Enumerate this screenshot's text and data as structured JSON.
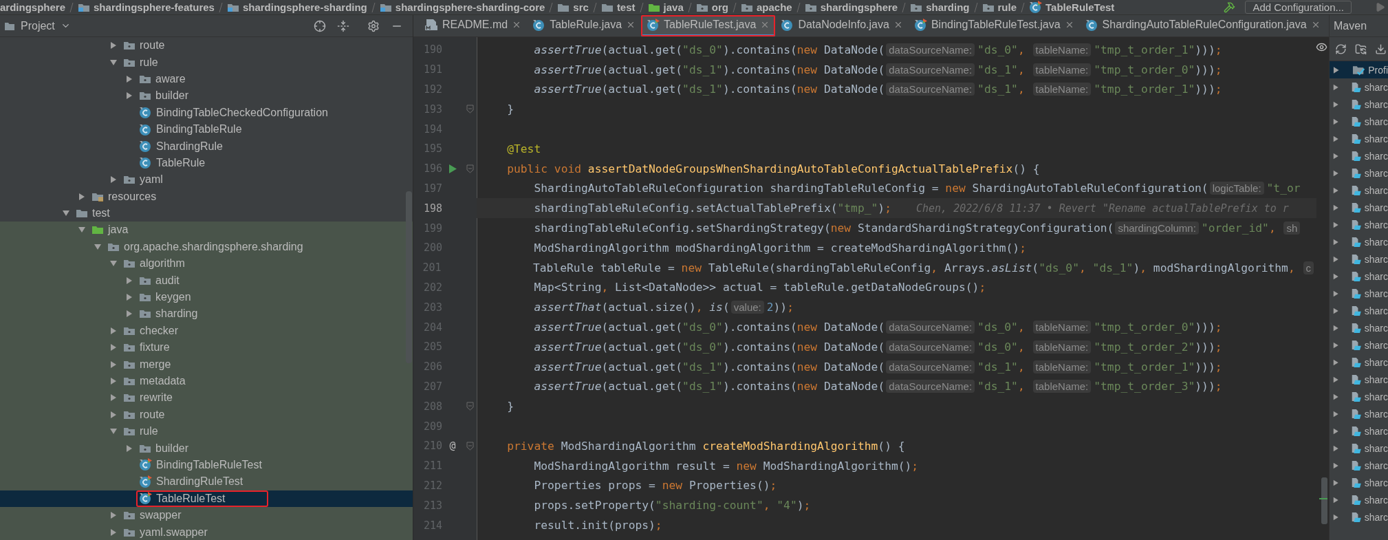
{
  "breadcrumb": [
    {
      "label": "ardingsphere",
      "kind": "none"
    },
    {
      "label": "shardingsphere-features",
      "kind": "module"
    },
    {
      "label": "shardingsphere-sharding",
      "kind": "module"
    },
    {
      "label": "shardingsphere-sharding-core",
      "kind": "module"
    },
    {
      "label": "src",
      "kind": "folder"
    },
    {
      "label": "test",
      "kind": "folder"
    },
    {
      "label": "java",
      "kind": "test-root"
    },
    {
      "label": "org",
      "kind": "package"
    },
    {
      "label": "apache",
      "kind": "package"
    },
    {
      "label": "shardingsphere",
      "kind": "package"
    },
    {
      "label": "sharding",
      "kind": "package"
    },
    {
      "label": "rule",
      "kind": "package"
    },
    {
      "label": "TableRuleTest",
      "kind": "test-class"
    }
  ],
  "run_config": {
    "label": "Add Configuration..."
  },
  "project_panel": {
    "title": "Project"
  },
  "tree": [
    {
      "children": [
        {
          "children": [
            {
              "children": [
                {
                  "label": "route",
                  "kind": "package",
                  "expanded": false,
                  "selected": false,
                  "outlined": false
                },
                {
                  "label": "rule",
                  "kind": "package",
                  "expanded": true,
                  "selected": false,
                  "outlined": false,
                  "children": [
                    {
                      "label": "aware",
                      "kind": "package",
                      "expanded": false,
                      "selected": false,
                      "outlined": false
                    },
                    {
                      "label": "builder",
                      "kind": "package",
                      "expanded": false,
                      "selected": false,
                      "outlined": false
                    },
                    {
                      "label": "BindingTableCheckedConfiguration",
                      "kind": "class",
                      "selected": false,
                      "outlined": false
                    },
                    {
                      "label": "BindingTableRule",
                      "kind": "class",
                      "selected": false,
                      "outlined": false
                    },
                    {
                      "label": "ShardingRule",
                      "kind": "class",
                      "selected": false,
                      "outlined": false
                    },
                    {
                      "label": "TableRule",
                      "kind": "class",
                      "selected": false,
                      "outlined": false
                    }
                  ]
                },
                {
                  "label": "yaml",
                  "kind": "package",
                  "expanded": false,
                  "selected": false,
                  "outlined": false
                }
              ]
            }
          ]
        },
        {
          "label": "resources",
          "kind": "resources",
          "expanded": false,
          "selected": false,
          "outlined": false
        }
      ]
    },
    {
      "label": "test",
      "kind": "folder",
      "expanded": true,
      "selected": false,
      "outlined": false,
      "children": [
        {
          "label": "java",
          "kind": "test-root",
          "expanded": true,
          "selected": false,
          "outlined": false,
          "children": [
            {
              "label": "org.apache.shardingsphere.sharding",
              "kind": "package",
              "expanded": true,
              "selected": false,
              "outlined": false,
              "children": [
                {
                  "label": "algorithm",
                  "kind": "package",
                  "expanded": true,
                  "selected": false,
                  "outlined": false,
                  "children": [
                    {
                      "label": "audit",
                      "kind": "package",
                      "expanded": false,
                      "selected": false,
                      "outlined": false
                    },
                    {
                      "label": "keygen",
                      "kind": "package",
                      "expanded": false,
                      "selected": false,
                      "outlined": false
                    },
                    {
                      "label": "sharding",
                      "kind": "package",
                      "expanded": false,
                      "selected": false,
                      "outlined": false
                    }
                  ]
                },
                {
                  "label": "checker",
                  "kind": "package",
                  "expanded": false,
                  "selected": false,
                  "outlined": false
                },
                {
                  "label": "fixture",
                  "kind": "package",
                  "expanded": false,
                  "selected": false,
                  "outlined": false
                },
                {
                  "label": "merge",
                  "kind": "package",
                  "expanded": false,
                  "selected": false,
                  "outlined": false
                },
                {
                  "label": "metadata",
                  "kind": "package",
                  "expanded": false,
                  "selected": false,
                  "outlined": false
                },
                {
                  "label": "rewrite",
                  "kind": "package",
                  "expanded": false,
                  "selected": false,
                  "outlined": false
                },
                {
                  "label": "route",
                  "kind": "package",
                  "expanded": false,
                  "selected": false,
                  "outlined": false
                },
                {
                  "label": "rule",
                  "kind": "package",
                  "expanded": true,
                  "selected": false,
                  "outlined": false,
                  "children": [
                    {
                      "label": "builder",
                      "kind": "package",
                      "expanded": false,
                      "selected": false,
                      "outlined": false
                    },
                    {
                      "label": "BindingTableRuleTest",
                      "kind": "test-class",
                      "selected": false,
                      "outlined": false
                    },
                    {
                      "label": "ShardingRuleTest",
                      "kind": "test-class",
                      "selected": false,
                      "outlined": false
                    },
                    {
                      "label": "TableRuleTest",
                      "kind": "test-class",
                      "selected": true,
                      "outlined": true
                    }
                  ]
                },
                {
                  "label": "swapper",
                  "kind": "package",
                  "expanded": false,
                  "selected": false,
                  "outlined": false
                },
                {
                  "label": "yaml.swapper",
                  "kind": "package",
                  "expanded": false,
                  "selected": false,
                  "outlined": false
                }
              ]
            }
          ]
        }
      ]
    }
  ],
  "tabs": [
    {
      "label": "README.md",
      "kind": "markdown",
      "selected": false,
      "outlined": false
    },
    {
      "label": "TableRule.java",
      "kind": "class",
      "selected": false,
      "outlined": false
    },
    {
      "label": "TableRuleTest.java",
      "kind": "test-class",
      "selected": true,
      "outlined": true
    },
    {
      "label": "DataNodeInfo.java",
      "kind": "class",
      "selected": false,
      "outlined": false
    },
    {
      "label": "BindingTableRuleTest.java",
      "kind": "test-class",
      "selected": false,
      "outlined": false
    },
    {
      "label": "ShardingAutoTableRuleConfiguration.java",
      "kind": "class",
      "selected": false,
      "outlined": false
    }
  ],
  "lines": [
    {
      "number": "190",
      "current": false,
      "fold": false,
      "run": false,
      "tokens": [
        {
          "kind": "italic",
          "text": "        assertTrue"
        },
        {
          "kind": "plain",
          "text": "(actual.get("
        },
        {
          "kind": "string",
          "text": "\"ds_0\""
        },
        {
          "kind": "plain",
          "text": ").contains("
        },
        {
          "kind": "keyword",
          "text": "new"
        },
        {
          "kind": "plain",
          "text": " DataNode("
        },
        {
          "kind": "hint",
          "text": "dataSourceName:"
        },
        {
          "kind": "string",
          "text": "\"ds_0\""
        },
        {
          "kind": "keyword",
          "text": ", "
        },
        {
          "kind": "hint",
          "text": "tableName:"
        },
        {
          "kind": "string",
          "text": "\"tmp_t_order_1\""
        },
        {
          "kind": "plain",
          "text": ")))"
        },
        {
          "kind": "keyword",
          "text": ";"
        }
      ]
    },
    {
      "number": "191",
      "current": false,
      "fold": false,
      "run": false,
      "tokens": [
        {
          "kind": "italic",
          "text": "        assertTrue"
        },
        {
          "kind": "plain",
          "text": "(actual.get("
        },
        {
          "kind": "string",
          "text": "\"ds_1\""
        },
        {
          "kind": "plain",
          "text": ").contains("
        },
        {
          "kind": "keyword",
          "text": "new"
        },
        {
          "kind": "plain",
          "text": " DataNode("
        },
        {
          "kind": "hint",
          "text": "dataSourceName:"
        },
        {
          "kind": "string",
          "text": "\"ds_1\""
        },
        {
          "kind": "keyword",
          "text": ", "
        },
        {
          "kind": "hint",
          "text": "tableName:"
        },
        {
          "kind": "string",
          "text": "\"tmp_t_order_0\""
        },
        {
          "kind": "plain",
          "text": ")))"
        },
        {
          "kind": "keyword",
          "text": ";"
        }
      ]
    },
    {
      "number": "192",
      "current": false,
      "fold": false,
      "run": false,
      "tokens": [
        {
          "kind": "italic",
          "text": "        assertTrue"
        },
        {
          "kind": "plain",
          "text": "(actual.get("
        },
        {
          "kind": "string",
          "text": "\"ds_1\""
        },
        {
          "kind": "plain",
          "text": ").contains("
        },
        {
          "kind": "keyword",
          "text": "new"
        },
        {
          "kind": "plain",
          "text": " DataNode("
        },
        {
          "kind": "hint",
          "text": "dataSourceName:"
        },
        {
          "kind": "string",
          "text": "\"ds_1\""
        },
        {
          "kind": "keyword",
          "text": ", "
        },
        {
          "kind": "hint",
          "text": "tableName:"
        },
        {
          "kind": "string",
          "text": "\"tmp_t_order_1\""
        },
        {
          "kind": "plain",
          "text": ")))"
        },
        {
          "kind": "keyword",
          "text": ";"
        }
      ]
    },
    {
      "number": "193",
      "current": false,
      "fold": true,
      "run": false,
      "tokens": [
        {
          "kind": "plain",
          "text": "    }"
        }
      ]
    },
    {
      "number": "194",
      "current": false,
      "fold": false,
      "run": false
    },
    {
      "number": "195",
      "current": false,
      "fold": false,
      "run": false,
      "tokens": [
        {
          "kind": "annotation",
          "text": "    @Test"
        }
      ]
    },
    {
      "number": "196",
      "current": false,
      "fold": true,
      "run": true,
      "tokens": [
        {
          "kind": "keyword",
          "text": "    public void "
        },
        {
          "kind": "declaration",
          "text": "assertDatNodeGroupsWhenShardingAutoTableConfigActualTablePrefix"
        },
        {
          "kind": "plain",
          "text": "() {"
        }
      ]
    },
    {
      "number": "197",
      "current": false,
      "fold": false,
      "run": false,
      "tokens": [
        {
          "kind": "plain",
          "text": "        ShardingAutoTableRuleConfiguration shardingTableRuleConfig = "
        },
        {
          "kind": "keyword",
          "text": "new"
        },
        {
          "kind": "plain",
          "text": " ShardingAutoTableRuleConfiguration("
        },
        {
          "kind": "hint",
          "text": "logicTable:"
        },
        {
          "kind": "string",
          "text": "\"t_or"
        }
      ]
    },
    {
      "number": "198",
      "current": true,
      "fold": false,
      "run": false,
      "tokens": [
        {
          "kind": "plain",
          "text": "        shardingTableRuleConfig.setActualTablePrefix("
        },
        {
          "kind": "string",
          "text": "\"tmp_\""
        },
        {
          "kind": "plain",
          "text": ")"
        },
        {
          "kind": "keyword",
          "text": ";"
        },
        {
          "kind": "blame",
          "text": "Chen, 2022/6/8 11:37 • Revert \"Rename actualTablePrefix to r"
        }
      ]
    },
    {
      "number": "199",
      "current": false,
      "fold": false,
      "run": false,
      "tokens": [
        {
          "kind": "plain",
          "text": "        shardingTableRuleConfig.setShardingStrategy("
        },
        {
          "kind": "keyword",
          "text": "new"
        },
        {
          "kind": "plain",
          "text": " StandardShardingStrategyConfiguration("
        },
        {
          "kind": "hint",
          "text": "shardingColumn:"
        },
        {
          "kind": "string",
          "text": "\"order_id\""
        },
        {
          "kind": "keyword",
          "text": ", "
        },
        {
          "kind": "hint",
          "text": "sh"
        }
      ]
    },
    {
      "number": "200",
      "current": false,
      "fold": false,
      "run": false,
      "tokens": [
        {
          "kind": "plain",
          "text": "        ModShardingAlgorithm modShardingAlgorithm = createModShardingAlgorithm()"
        },
        {
          "kind": "keyword",
          "text": ";"
        }
      ]
    },
    {
      "number": "201",
      "current": false,
      "fold": false,
      "run": false,
      "tokens": [
        {
          "kind": "plain",
          "text": "        TableRule tableRule = "
        },
        {
          "kind": "keyword",
          "text": "new"
        },
        {
          "kind": "plain",
          "text": " TableRule(shardingTableRuleConfig"
        },
        {
          "kind": "keyword",
          "text": ", "
        },
        {
          "kind": "plain",
          "text": "Arrays."
        },
        {
          "kind": "italic",
          "text": "asList"
        },
        {
          "kind": "plain",
          "text": "("
        },
        {
          "kind": "string",
          "text": "\"ds_0\""
        },
        {
          "kind": "keyword",
          "text": ", "
        },
        {
          "kind": "string",
          "text": "\"ds_1\""
        },
        {
          "kind": "plain",
          "text": ")"
        },
        {
          "kind": "keyword",
          "text": ", "
        },
        {
          "kind": "plain",
          "text": "modShardingAlgorithm"
        },
        {
          "kind": "keyword",
          "text": ", "
        },
        {
          "kind": "hint",
          "text": "c"
        }
      ]
    },
    {
      "number": "202",
      "current": false,
      "fold": false,
      "run": false,
      "tokens": [
        {
          "kind": "plain",
          "text": "        Map<String"
        },
        {
          "kind": "keyword",
          "text": ", "
        },
        {
          "kind": "plain",
          "text": "List<DataNode>> actual = tableRule.getDataNodeGroups()"
        },
        {
          "kind": "keyword",
          "text": ";"
        }
      ]
    },
    {
      "number": "203",
      "current": false,
      "fold": false,
      "run": false,
      "tokens": [
        {
          "kind": "italic",
          "text": "        assertThat"
        },
        {
          "kind": "plain",
          "text": "(actual.size()"
        },
        {
          "kind": "keyword",
          "text": ", "
        },
        {
          "kind": "italic",
          "text": "is"
        },
        {
          "kind": "plain",
          "text": "("
        },
        {
          "kind": "hint",
          "text": "value:"
        },
        {
          "kind": "number",
          "text": "2"
        },
        {
          "kind": "plain",
          "text": "))"
        },
        {
          "kind": "keyword",
          "text": ";"
        }
      ]
    },
    {
      "number": "204",
      "current": false,
      "fold": false,
      "run": false,
      "tokens": [
        {
          "kind": "italic",
          "text": "        assertTrue"
        },
        {
          "kind": "plain",
          "text": "(actual.get("
        },
        {
          "kind": "string",
          "text": "\"ds_0\""
        },
        {
          "kind": "plain",
          "text": ").contains("
        },
        {
          "kind": "keyword",
          "text": "new"
        },
        {
          "kind": "plain",
          "text": " DataNode("
        },
        {
          "kind": "hint",
          "text": "dataSourceName:"
        },
        {
          "kind": "string",
          "text": "\"ds_0\""
        },
        {
          "kind": "keyword",
          "text": ", "
        },
        {
          "kind": "hint",
          "text": "tableName:"
        },
        {
          "kind": "string",
          "text": "\"tmp_t_order_0\""
        },
        {
          "kind": "plain",
          "text": ")))"
        },
        {
          "kind": "keyword",
          "text": ";"
        }
      ]
    },
    {
      "number": "205",
      "current": false,
      "fold": false,
      "run": false,
      "tokens": [
        {
          "kind": "italic",
          "text": "        assertTrue"
        },
        {
          "kind": "plain",
          "text": "(actual.get("
        },
        {
          "kind": "string",
          "text": "\"ds_0\""
        },
        {
          "kind": "plain",
          "text": ").contains("
        },
        {
          "kind": "keyword",
          "text": "new"
        },
        {
          "kind": "plain",
          "text": " DataNode("
        },
        {
          "kind": "hint",
          "text": "dataSourceName:"
        },
        {
          "kind": "string",
          "text": "\"ds_0\""
        },
        {
          "kind": "keyword",
          "text": ", "
        },
        {
          "kind": "hint",
          "text": "tableName:"
        },
        {
          "kind": "string",
          "text": "\"tmp_t_order_2\""
        },
        {
          "kind": "plain",
          "text": ")))"
        },
        {
          "kind": "keyword",
          "text": ";"
        }
      ]
    },
    {
      "number": "206",
      "current": false,
      "fold": false,
      "run": false,
      "tokens": [
        {
          "kind": "italic",
          "text": "        assertTrue"
        },
        {
          "kind": "plain",
          "text": "(actual.get("
        },
        {
          "kind": "string",
          "text": "\"ds_1\""
        },
        {
          "kind": "plain",
          "text": ").contains("
        },
        {
          "kind": "keyword",
          "text": "new"
        },
        {
          "kind": "plain",
          "text": " DataNode("
        },
        {
          "kind": "hint",
          "text": "dataSourceName:"
        },
        {
          "kind": "string",
          "text": "\"ds_1\""
        },
        {
          "kind": "keyword",
          "text": ", "
        },
        {
          "kind": "hint",
          "text": "tableName:"
        },
        {
          "kind": "string",
          "text": "\"tmp_t_order_1\""
        },
        {
          "kind": "plain",
          "text": ")))"
        },
        {
          "kind": "keyword",
          "text": ";"
        }
      ]
    },
    {
      "number": "207",
      "current": false,
      "fold": false,
      "run": false,
      "tokens": [
        {
          "kind": "italic",
          "text": "        assertTrue"
        },
        {
          "kind": "plain",
          "text": "(actual.get("
        },
        {
          "kind": "string",
          "text": "\"ds_1\""
        },
        {
          "kind": "plain",
          "text": ").contains("
        },
        {
          "kind": "keyword",
          "text": "new"
        },
        {
          "kind": "plain",
          "text": " DataNode("
        },
        {
          "kind": "hint",
          "text": "dataSourceName:"
        },
        {
          "kind": "string",
          "text": "\"ds_1\""
        },
        {
          "kind": "keyword",
          "text": ", "
        },
        {
          "kind": "hint",
          "text": "tableName:"
        },
        {
          "kind": "string",
          "text": "\"tmp_t_order_3\""
        },
        {
          "kind": "plain",
          "text": ")))"
        },
        {
          "kind": "keyword",
          "text": ";"
        }
      ]
    },
    {
      "number": "208",
      "current": false,
      "fold": true,
      "run": false,
      "tokens": [
        {
          "kind": "plain",
          "text": "    }"
        }
      ]
    },
    {
      "number": "209",
      "current": false,
      "fold": false,
      "run": false
    },
    {
      "number": "210",
      "current": false,
      "fold": true,
      "run": false,
      "gutter_mark": "@",
      "tokens": [
        {
          "kind": "keyword",
          "text": "    private"
        },
        {
          "kind": "plain",
          "text": " ModShardingAlgorithm "
        },
        {
          "kind": "declaration",
          "text": "createModShardingAlgorithm"
        },
        {
          "kind": "plain",
          "text": "() {"
        }
      ]
    },
    {
      "number": "211",
      "current": false,
      "fold": false,
      "run": false,
      "tokens": [
        {
          "kind": "plain",
          "text": "        ModShardingAlgorithm result = "
        },
        {
          "kind": "keyword",
          "text": "new"
        },
        {
          "kind": "plain",
          "text": " ModShardingAlgorithm()"
        },
        {
          "kind": "keyword",
          "text": ";"
        }
      ]
    },
    {
      "number": "212",
      "current": false,
      "fold": false,
      "run": false,
      "tokens": [
        {
          "kind": "plain",
          "text": "        Properties props = "
        },
        {
          "kind": "keyword",
          "text": "new"
        },
        {
          "kind": "plain",
          "text": " Properties()"
        },
        {
          "kind": "keyword",
          "text": ";"
        }
      ]
    },
    {
      "number": "213",
      "current": false,
      "fold": false,
      "run": false,
      "tokens": [
        {
          "kind": "plain",
          "text": "        props.setProperty("
        },
        {
          "kind": "string",
          "text": "\"sharding-count\""
        },
        {
          "kind": "keyword",
          "text": ", "
        },
        {
          "kind": "string",
          "text": "\"4\""
        },
        {
          "kind": "plain",
          "text": ")"
        },
        {
          "kind": "keyword",
          "text": ";"
        }
      ]
    },
    {
      "number": "214",
      "current": false,
      "fold": false,
      "run": false,
      "tokens": [
        {
          "kind": "plain",
          "text": "        result.init(props)"
        },
        {
          "kind": "keyword",
          "text": ";"
        }
      ]
    }
  ],
  "maven_panel": {
    "title": "Maven",
    "items": [
      {
        "label": "Profi",
        "kind": "profiles",
        "selected": true
      },
      {
        "label": "sharc",
        "kind": "module",
        "selected": false
      },
      {
        "label": "sharc",
        "kind": "module",
        "selected": false
      },
      {
        "label": "sharc",
        "kind": "module",
        "selected": false
      },
      {
        "label": "sharc",
        "kind": "module",
        "selected": false
      },
      {
        "label": "sharc",
        "kind": "module",
        "selected": false
      },
      {
        "label": "sharc",
        "kind": "module",
        "selected": false
      },
      {
        "label": "sharc",
        "kind": "module",
        "selected": false
      },
      {
        "label": "sharc",
        "kind": "module",
        "selected": false
      },
      {
        "label": "sharc",
        "kind": "module",
        "selected": false
      },
      {
        "label": "sharc",
        "kind": "module",
        "selected": false
      },
      {
        "label": "sharc",
        "kind": "module",
        "selected": false
      },
      {
        "label": "sharc",
        "kind": "module",
        "selected": false
      },
      {
        "label": "sharc",
        "kind": "module",
        "selected": false
      },
      {
        "label": "sharc",
        "kind": "module",
        "selected": false
      },
      {
        "label": "sharc",
        "kind": "module",
        "selected": false
      },
      {
        "label": "sharc",
        "kind": "module",
        "selected": false
      },
      {
        "label": "sharc",
        "kind": "module",
        "selected": false
      },
      {
        "label": "sharc",
        "kind": "module",
        "selected": false
      },
      {
        "label": "sharc",
        "kind": "module",
        "selected": false
      },
      {
        "label": "sharc",
        "kind": "module",
        "selected": false
      },
      {
        "label": "sharc",
        "kind": "module",
        "selected": false
      },
      {
        "label": "sharc",
        "kind": "module",
        "selected": false
      },
      {
        "label": "sharc",
        "kind": "module",
        "selected": false
      },
      {
        "label": "sharc",
        "kind": "module",
        "selected": false
      },
      {
        "label": "sharc",
        "kind": "module",
        "selected": false
      },
      {
        "label": "sharc",
        "kind": "module",
        "selected": false
      }
    ]
  }
}
